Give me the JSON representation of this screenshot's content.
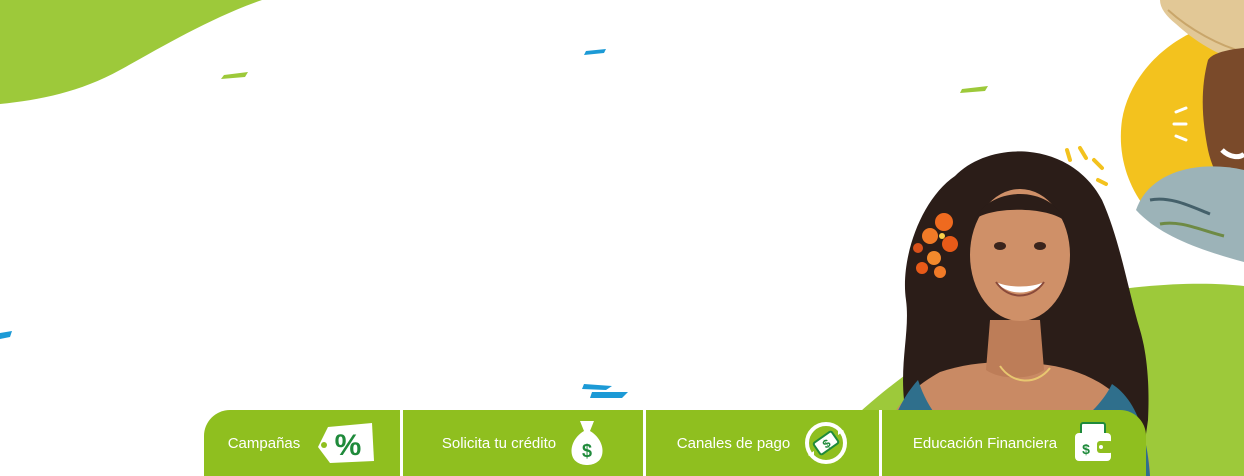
{
  "colors": {
    "brand_green": "#8fbf1f",
    "wave_green": "#9dc93a",
    "accent_blue": "#1c9ad6",
    "accent_yellow": "#f3c21e",
    "icon_dark_green": "#1f8a3b",
    "text_on_green": "#ffffff"
  },
  "nav": {
    "items": [
      {
        "label": "Campañas",
        "icon": "percent-tag-icon"
      },
      {
        "label": "Solicita tu crédito",
        "icon": "money-bag-icon"
      },
      {
        "label": "Canales de pago",
        "icon": "cash-cycle-icon"
      },
      {
        "label": "Educación Financiera",
        "icon": "wallet-icon"
      }
    ]
  },
  "hero": {
    "people": [
      "woman-with-flower-photo",
      "man-with-hat-photo"
    ]
  }
}
